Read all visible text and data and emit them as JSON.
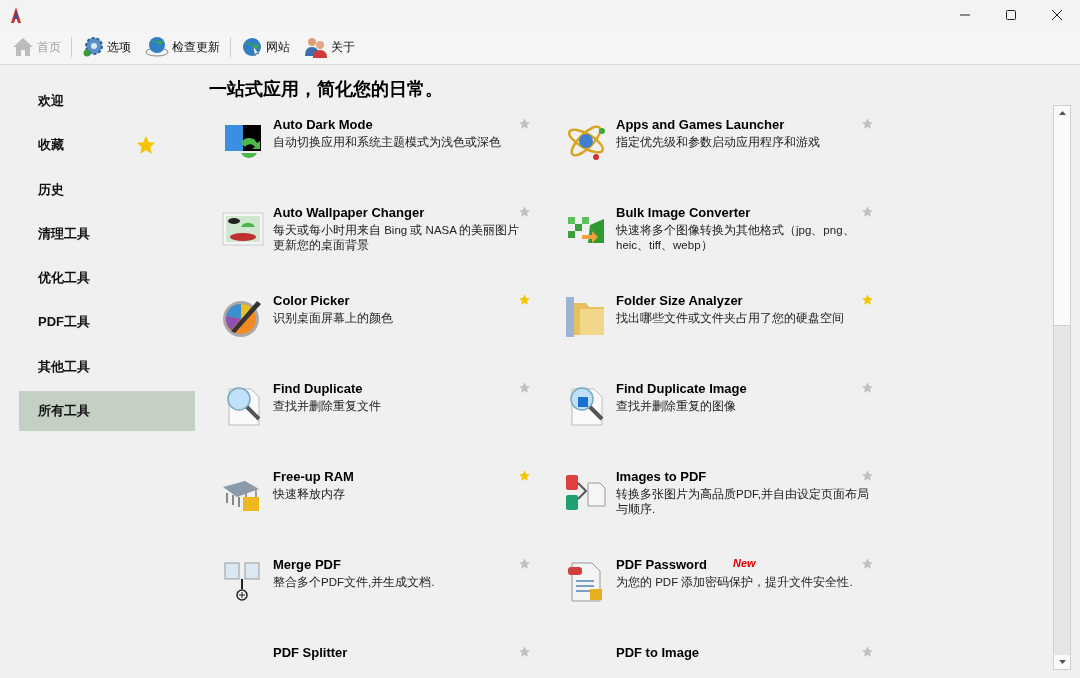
{
  "toolbar": [
    {
      "label": "首页",
      "disabled": true
    },
    {
      "label": "选项",
      "disabled": false
    },
    {
      "label": "检查更新",
      "disabled": false
    },
    {
      "label": "网站",
      "disabled": false
    },
    {
      "label": "关于",
      "disabled": false
    }
  ],
  "sidebar": {
    "items": [
      {
        "label": "欢迎",
        "selected": false,
        "starred": false
      },
      {
        "label": "收藏",
        "selected": false,
        "starred": true
      },
      {
        "label": "历史",
        "selected": false,
        "starred": false
      },
      {
        "label": "清理工具",
        "selected": false,
        "starred": false
      },
      {
        "label": "优化工具",
        "selected": false,
        "starred": false
      },
      {
        "label": "PDF工具",
        "selected": false,
        "starred": false
      },
      {
        "label": "其他工具",
        "selected": false,
        "starred": false
      },
      {
        "label": "所有工具",
        "selected": true,
        "starred": false
      }
    ]
  },
  "heading": "一站式应用，简化您的日常。",
  "tools": [
    {
      "title": "Auto Dark Mode",
      "description": "自动切换应用和系统主题模式为浅色或深色",
      "starred": false
    },
    {
      "title": "Apps and Games Launcher",
      "description": "指定优先级和参数启动应用程序和游戏",
      "starred": false
    },
    {
      "title": "Auto Wallpaper Changer",
      "description": "每天或每小时用来自 Bing 或 NASA 的美丽图片更新您的桌面背景",
      "starred": false
    },
    {
      "title": "Bulk Image Converter",
      "description": "快速将多个图像转换为其他格式（jpg、png、heic、tiff、webp）",
      "starred": false
    },
    {
      "title": "Color Picker",
      "description": "识别桌面屏幕上的颜色",
      "starred": true
    },
    {
      "title": "Folder Size Analyzer",
      "description": "找出哪些文件或文件夹占用了您的硬盘空间",
      "starred": true
    },
    {
      "title": "Find Duplicate",
      "description": "查找并删除重复文件",
      "starred": false
    },
    {
      "title": "Find Duplicate Image",
      "description": "查找并删除重复的图像",
      "starred": false
    },
    {
      "title": "Free-up RAM",
      "description": "快速释放内存",
      "starred": true
    },
    {
      "title": "Images to PDF",
      "description": "转换多张图片为高品质PDF,并自由设定页面布局与顺序.",
      "starred": false
    },
    {
      "title": "Merge PDF",
      "description": "整合多个PDF文件,并生成文档.",
      "starred": false
    },
    {
      "title": "PDF Password",
      "description": "为您的 PDF 添加密码保护，提升文件安全性.",
      "starred": false,
      "badge": "New"
    },
    {
      "title": "PDF Splitter",
      "starred": false
    },
    {
      "title": "PDF to Image",
      "starred": false
    }
  ]
}
